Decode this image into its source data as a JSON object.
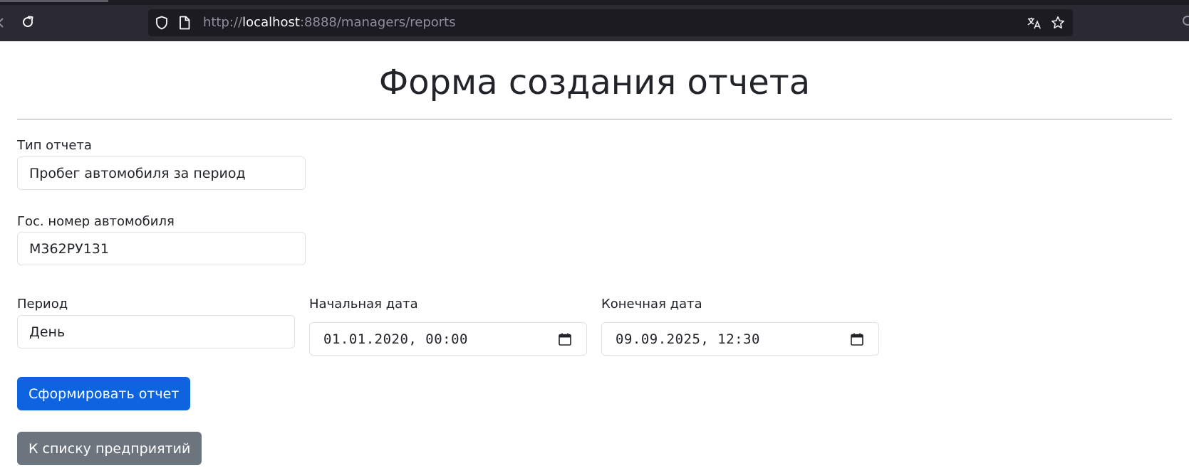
{
  "browser": {
    "url_prefix": "http://",
    "url_host": "localhost",
    "url_rest": ":8888/managers/reports"
  },
  "page": {
    "title": "Форма создания отчета"
  },
  "form": {
    "report_type": {
      "label": "Тип отчета",
      "value": "Пробег автомобиля за период"
    },
    "car_number": {
      "label": "Гос. номер автомобиля",
      "value": "М362РУ131"
    },
    "period": {
      "label": "Период",
      "value": "День"
    },
    "start_date": {
      "label": "Начальная дата",
      "value": "01.01.2020, 00:00"
    },
    "end_date": {
      "label": "Конечная дата",
      "value": "09.09.2025, 12:30"
    },
    "submit_label": "Сформировать отчет",
    "back_label": "К списку предприятий"
  },
  "colors": {
    "primary": "#0d63e0",
    "secondary": "#6c757d",
    "chrome_bg": "#2b2a33",
    "urlbar_bg": "#1c1b22"
  },
  "icons": [
    "reload-icon",
    "shield-icon",
    "page-icon",
    "translate-icon",
    "star-icon",
    "calendar-icon"
  ]
}
